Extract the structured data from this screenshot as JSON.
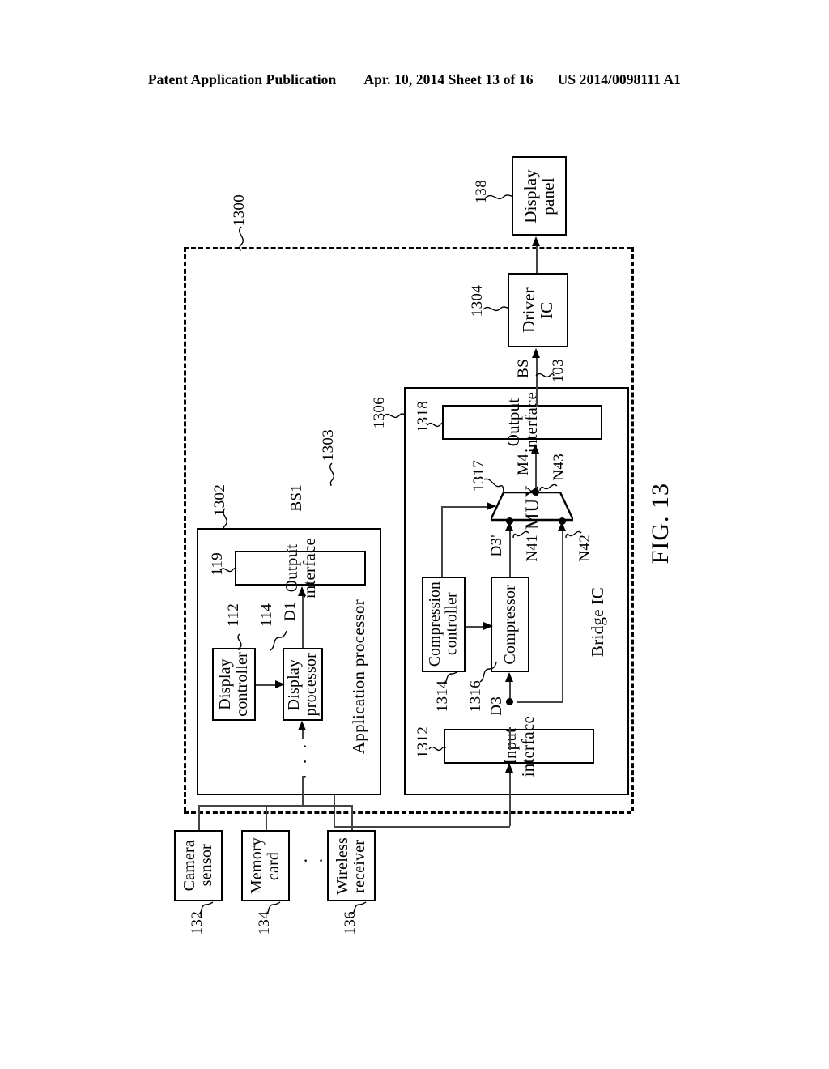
{
  "header": {
    "publication": "Patent Application Publication",
    "date_sheet": "Apr. 10, 2014  Sheet 13 of 16",
    "patent_number": "US 2014/0098111 A1"
  },
  "figure": {
    "label": "FIG. 13",
    "system_ref": "1300"
  },
  "blocks": {
    "display_panel": {
      "label": "Display\npanel",
      "ref": "138"
    },
    "driver_ic": {
      "label": "Driver\nIC",
      "ref": "1304"
    },
    "application_processor": {
      "label": "Application processor",
      "ref": "1302"
    },
    "ap_output_interface": {
      "label": "Output interface",
      "ref": "119"
    },
    "display_controller": {
      "label": "Display\ncontroller",
      "ref": "112"
    },
    "display_processor": {
      "label": "Display\nprocessor",
      "ref": "114"
    },
    "bridge_ic": {
      "label": "Bridge IC",
      "ref": "1306"
    },
    "bridge_input_interface": {
      "label": "Input interface",
      "ref": "1312"
    },
    "compression_controller": {
      "label": "Compression\ncontroller",
      "ref": "1314"
    },
    "compressor": {
      "label": "Compressor",
      "ref": "1316"
    },
    "mux": {
      "label": "MUX",
      "ref": "1317"
    },
    "bridge_output_interface": {
      "label": "Output interface",
      "ref": "1318"
    },
    "camera_sensor": {
      "label": "Camera\nsensor",
      "ref": "132"
    },
    "memory_card": {
      "label": "Memory\ncard",
      "ref": "134"
    },
    "wireless_receiver": {
      "label": "Wireless\nreceiver",
      "ref": "136"
    }
  },
  "signals": {
    "bs": "BS",
    "bs_ref": "103",
    "bs1": "BS1",
    "bs1_ref": "1303",
    "d1": "D1",
    "d3": "D3",
    "d3p": "D3'",
    "m4": "M4",
    "n41": "N41",
    "n42": "N42",
    "n43": "N43"
  },
  "misc": {
    "ellipsis": "· · ·",
    "ellipsis_v": "· · ·"
  }
}
